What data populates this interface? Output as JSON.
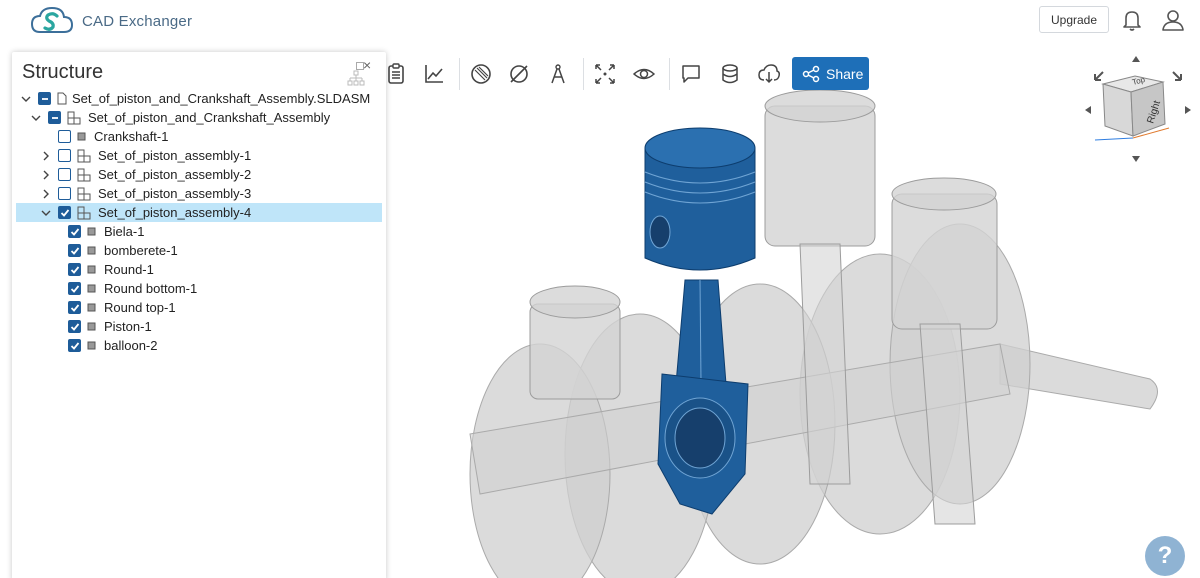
{
  "app": {
    "name": "CAD Exchanger"
  },
  "header": {
    "upgrade_label": "Upgrade",
    "icons": [
      "bell-icon",
      "user-icon"
    ]
  },
  "toolbar": {
    "share_label": "Share",
    "icons": [
      "clipboard-icon",
      "chart-icon",
      "section-icon",
      "hide-icon",
      "measure-icon",
      "fit-view-icon",
      "visibility-icon",
      "comment-icon",
      "database-icon",
      "cloud-download-icon",
      "share-icon"
    ]
  },
  "structure": {
    "title": "Structure",
    "close_glyph": "×",
    "items": [
      {
        "label": "Set_of_piston_and_Crankshaft_Assembly.SLDASM",
        "type": "file",
        "expanded": true,
        "state": "partial"
      },
      {
        "label": "Set_of_piston_and_Crankshaft_Assembly",
        "type": "assembly",
        "expanded": true,
        "state": "partial"
      },
      {
        "label": "Crankshaft-1",
        "type": "part",
        "state": "unchecked"
      },
      {
        "label": "Set_of_piston_assembly-1",
        "type": "assembly",
        "expanded": false,
        "state": "unchecked"
      },
      {
        "label": "Set_of_piston_assembly-2",
        "type": "assembly",
        "expanded": false,
        "state": "unchecked"
      },
      {
        "label": "Set_of_piston_assembly-3",
        "type": "assembly",
        "expanded": false,
        "state": "unchecked"
      },
      {
        "label": "Set_of_piston_assembly-4",
        "type": "assembly",
        "expanded": true,
        "state": "checked",
        "selected": true
      },
      {
        "label": "Biela-1",
        "type": "part",
        "state": "checked"
      },
      {
        "label": "bomberete-1",
        "type": "part",
        "state": "checked"
      },
      {
        "label": "Round-1",
        "type": "part",
        "state": "checked"
      },
      {
        "label": "Round bottom-1",
        "type": "part",
        "state": "checked"
      },
      {
        "label": "Round top-1",
        "type": "part",
        "state": "checked"
      },
      {
        "label": "Piston-1",
        "type": "part",
        "state": "checked"
      },
      {
        "label": "balloon-2",
        "type": "part",
        "state": "checked"
      }
    ]
  },
  "viewcube": {
    "top_label": "Top",
    "right_label": "Right"
  },
  "help": {
    "label": "?"
  },
  "colors": {
    "accent": "#1e6fb8",
    "checkbox": "#1e5c99",
    "selected_row": "#bfe5f9",
    "model_blue": "#1f5f9c",
    "ghost_gray": "#c9c9c9"
  }
}
